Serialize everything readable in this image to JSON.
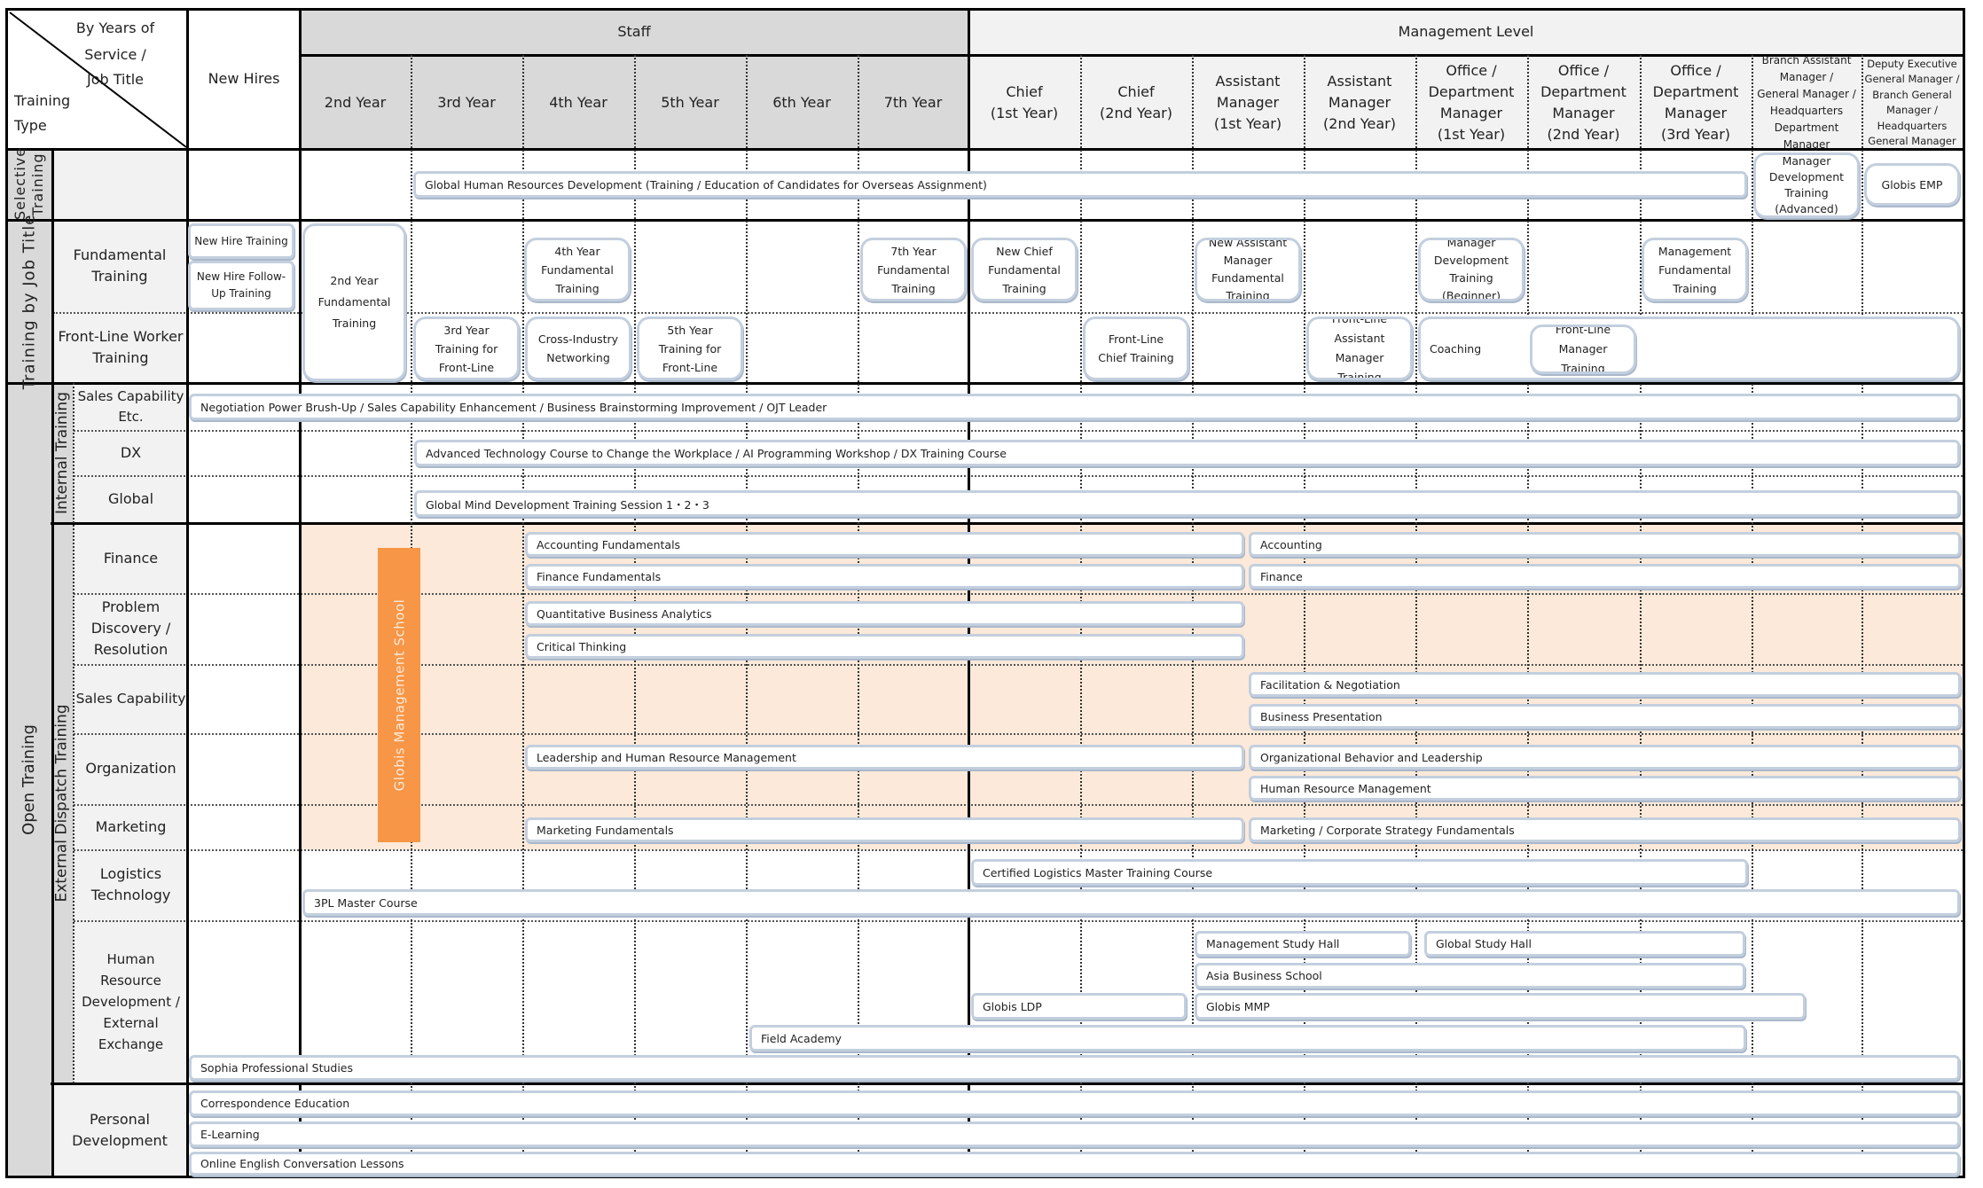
{
  "corner": {
    "top_right": "By Years of Service / Job Title",
    "top_right_lines": [
      "By Years of",
      "Service /",
      "Job Title"
    ],
    "bottom_left_lines": [
      "Training",
      "Type"
    ]
  },
  "header": {
    "new_hires": "New Hires",
    "staff_group": "Staff",
    "management_group": "Management Level",
    "staff_columns": [
      "2nd Year",
      "3rd Year",
      "4th Year",
      "5th Year",
      "6th Year",
      "7th Year"
    ],
    "management_columns": [
      [
        "Chief",
        "(1st Year)"
      ],
      [
        "Chief",
        "(2nd Year)"
      ],
      [
        "Assistant",
        "Manager",
        "(1st Year)"
      ],
      [
        "Assistant",
        "Manager",
        "(2nd Year)"
      ],
      [
        "Office /",
        "Department",
        "Manager",
        "(1st Year)"
      ],
      [
        "Office /",
        "Department",
        "Manager",
        "(2nd Year)"
      ],
      [
        "Office /",
        "Department",
        "Manager",
        "(3rd Year)"
      ],
      [
        "Branch Assistant",
        "Manager /",
        "General Manager /",
        "Headquarters",
        "Department Manager"
      ],
      [
        "Deputy Executive",
        "General Manager /",
        "Branch General",
        "Manager /",
        "Headquarters",
        "General Manager"
      ]
    ]
  },
  "categories": {
    "selective": "Selective Training",
    "by_job_title": "Training by Job Title",
    "open": "Open Training",
    "internal": "Internal Training",
    "external": "External Dispatch Training"
  },
  "row_labels": {
    "fundamental": "Fundamental Training",
    "front_line": "Front-Line Worker Training",
    "sales_etc": "Sales Capability Etc.",
    "dx": "DX",
    "global": "Global",
    "finance": "Finance",
    "problem": "Problem Discovery / Resolution",
    "sales_capability": "Sales Capability",
    "organization": "Organization",
    "marketing": "Marketing",
    "logistics": "Logistics Technology",
    "hr_dev": "Human Resource Development / External Exchange",
    "personal": "Personal Development"
  },
  "programs": {
    "selective": {
      "global_hr": "Global Human Resources Development (Training / Education of Candidates for Overseas Assignment)",
      "mgr_dev_advanced": "Manager Development Training (Advanced)",
      "globis_emp": "Globis EMP"
    },
    "fundamental": {
      "new_hire": "New Hire Training",
      "new_hire_followup": "New Hire Follow-Up Training",
      "year2": "2nd Year Fundamental Training",
      "year4": "4th Year Fundamental Training",
      "year7": "7th Year Fundamental Training",
      "new_chief": "New Chief Fundamental Training",
      "new_am": "New Assistant Manager Fundamental Training",
      "mgr_dev_beginner": "Manager Development Training (Beginner)",
      "mgmt_fundamental": "Management Fundamental Training"
    },
    "front_line": {
      "year3": "3rd Year Training for Front-Line",
      "cross_industry": "Cross-Industry Networking",
      "year5": "5th Year Training for Front-Line",
      "chief": "Front-Line Chief Training",
      "am": "Front-Line Assistant Manager Training",
      "coaching": "Coaching",
      "manager": "Front-Line Manager Training"
    },
    "internal": {
      "sales_etc": "Negotiation Power Brush-Up / Sales Capability Enhancement / Business Brainstorming Improvement / OJT Leader",
      "dx": "Advanced Technology Course to Change the Workplace / AI Programming Workshop / DX Training Course",
      "global": "Global Mind Development Training Session 1・2・3"
    },
    "external": {
      "globis_school": "Globis Management School",
      "accounting_fundamentals": "Accounting Fundamentals",
      "accounting": "Accounting",
      "finance_fundamentals": "Finance Fundamentals",
      "finance": "Finance",
      "quant": "Quantitative Business Analytics",
      "critical_thinking": "Critical Thinking",
      "facilitation": "Facilitation & Negotiation",
      "presentation": "Business Presentation",
      "leadership_hrm": "Leadership and Human Resource Management",
      "org_behavior": "Organizational Behavior and Leadership",
      "hrm": "Human Resource Management",
      "marketing_fundamentals": "Marketing Fundamentals",
      "marketing_strategy": "Marketing / Corporate Strategy Fundamentals",
      "certified_logistics": "Certified Logistics Master Training Course",
      "three_pl": "3PL Master Course",
      "mgmt_study_hall": "Management Study Hall",
      "global_study_hall": "Global Study Hall",
      "asia_business_school": "Asia Business School",
      "globis_ldp": "Globis LDP",
      "globis_mmp": "Globis MMP",
      "field_academy": "Field Academy",
      "sophia": "Sophia Professional Studies"
    },
    "personal": {
      "correspondence": "Correspondence Education",
      "elearning": "E-Learning",
      "english": "Online English Conversation Lessons"
    }
  },
  "colors": {
    "staff_header": "#d9d9d9",
    "management_header": "#f2f2f2",
    "label_fill": "#f2f2f2",
    "category_fill": "#d9d9d9",
    "highlight_fill": "#fde9d9",
    "globis_bar": "#f79646",
    "box_border": "#c3cfde"
  }
}
